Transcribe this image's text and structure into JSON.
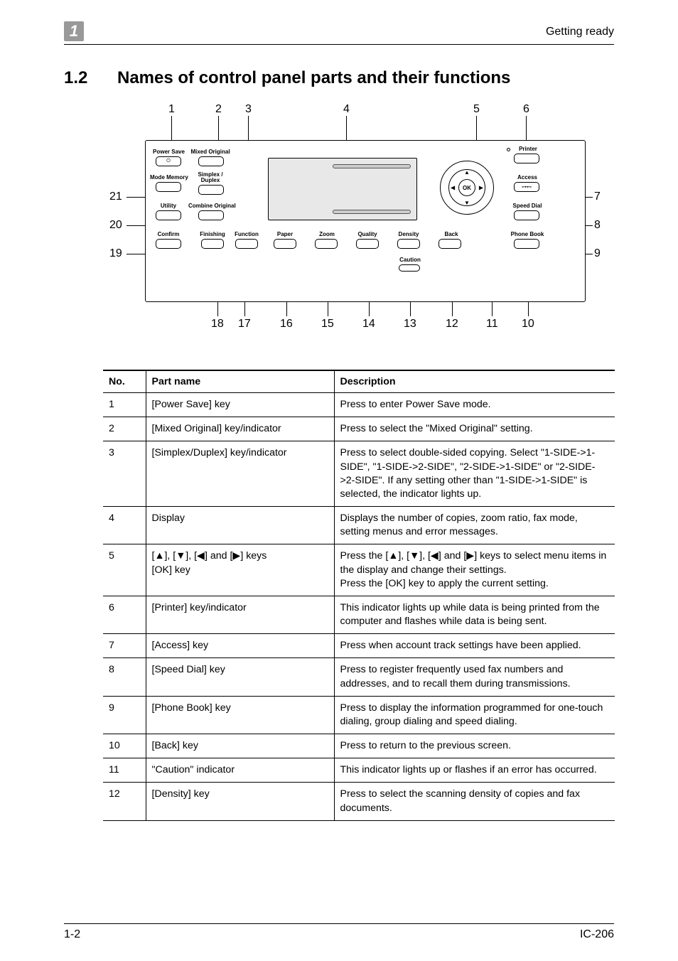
{
  "header": {
    "chapter_tab": "1",
    "right_text": "Getting ready"
  },
  "section": {
    "number": "1.2",
    "title": "Names of control panel parts and their functions"
  },
  "diagram": {
    "top_callouts": [
      "1",
      "2",
      "3",
      "4",
      "5",
      "6"
    ],
    "left_callouts": [
      "21",
      "20",
      "19"
    ],
    "right_callouts": [
      "7",
      "8",
      "9"
    ],
    "bottom_callouts": [
      "18",
      "17",
      "16",
      "15",
      "14",
      "13",
      "12",
      "11",
      "10"
    ],
    "panel_labels": {
      "power_save": "Power Save",
      "mixed_original": "Mixed Original",
      "mode_memory": "Mode Memory",
      "simplex_duplex": "Simplex /\nDuplex",
      "utility": "Utility",
      "combine_original": "Combine Original",
      "confirm": "Confirm",
      "finishing": "Finishing",
      "function": "Function",
      "paper": "Paper",
      "zoom": "Zoom",
      "quality": "Quality",
      "density": "Density",
      "back": "Back",
      "phone_book": "Phone Book",
      "speed_dial": "Speed Dial",
      "access": "Access",
      "printer": "Printer",
      "ok": "OK",
      "caution": "Caution"
    }
  },
  "table": {
    "headers": [
      "No.",
      "Part name",
      "Description"
    ],
    "rows": [
      {
        "no": "1",
        "part": "[Power Save] key",
        "desc": "Press to enter Power Save mode."
      },
      {
        "no": "2",
        "part": "[Mixed Original] key/indicator",
        "desc": "Press to select the \"Mixed Original\" setting."
      },
      {
        "no": "3",
        "part": "[Simplex/Duplex] key/indicator",
        "desc": "Press to select double-sided copying. Select \"1-SIDE->1-SIDE\", \"1-SIDE->2-SIDE\", \"2-SIDE->1-SIDE\" or \"2-SIDE->2-SIDE\". If any setting other than \"1-SIDE->1-SIDE\" is selected, the indicator lights up."
      },
      {
        "no": "4",
        "part": "Display",
        "desc": "Displays the number of copies, zoom ratio, fax mode, setting menus and error messages."
      },
      {
        "no": "5",
        "part": "[▲], [▼], [◀] and [▶] keys\n[OK] key",
        "desc": "Press the [▲], [▼], [◀] and [▶] keys to select menu items in the display and change their settings.\nPress the [OK] key to apply the current setting."
      },
      {
        "no": "6",
        "part": "[Printer] key/indicator",
        "desc": "This indicator lights up while data is being printed from the computer and flashes while data is being sent."
      },
      {
        "no": "7",
        "part": "[Access] key",
        "desc": "Press when account track settings have been applied."
      },
      {
        "no": "8",
        "part": "[Speed Dial] key",
        "desc": "Press to register frequently used fax numbers and addresses, and to recall them during transmissions."
      },
      {
        "no": "9",
        "part": "[Phone Book] key",
        "desc": "Press to display the information programmed for one-touch dialing, group dialing and speed dialing."
      },
      {
        "no": "10",
        "part": "[Back] key",
        "desc": "Press to return to the previous screen."
      },
      {
        "no": "11",
        "part": "\"Caution\" indicator",
        "desc": "This indicator lights up or flashes if an error has occurred."
      },
      {
        "no": "12",
        "part": "[Density] key",
        "desc": "Press to select the scanning density of copies and fax documents."
      }
    ]
  },
  "footer": {
    "left": "1-2",
    "right": "IC-206"
  }
}
